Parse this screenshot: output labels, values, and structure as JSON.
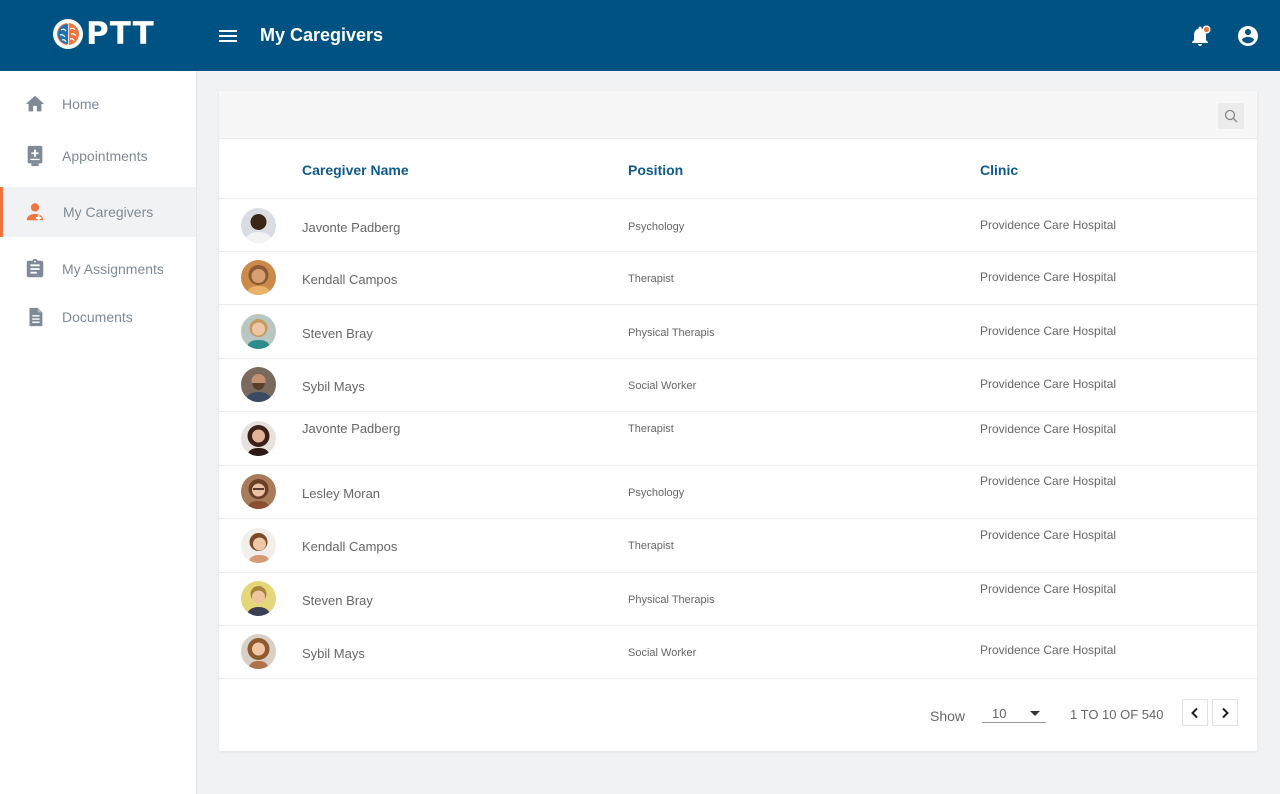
{
  "app": {
    "logo_text": "PTT"
  },
  "header": {
    "title": "My Caregivers"
  },
  "sidebar": {
    "items": [
      {
        "label": "Home",
        "icon": "home-icon"
      },
      {
        "label": "Appointments",
        "icon": "appointments-icon"
      },
      {
        "label": "My Caregivers",
        "icon": "caregiver-icon",
        "active": true
      },
      {
        "label": "My Assignments",
        "icon": "clipboard-icon"
      },
      {
        "label": "Documents",
        "icon": "document-icon"
      }
    ]
  },
  "table": {
    "headers": {
      "name": "Caregiver Name",
      "position": "Position",
      "clinic": "Clinic"
    },
    "rows": [
      {
        "name": "Javonte Padberg",
        "position": "Psychology",
        "clinic": "Providence Care Hospital"
      },
      {
        "name": "Kendall Campos",
        "position": "Therapist",
        "clinic": "Providence Care Hospital"
      },
      {
        "name": "Steven Bray",
        "position": "Physical Therapis",
        "clinic": "Providence Care Hospital"
      },
      {
        "name": "Sybil Mays",
        "position": "Social Worker",
        "clinic": "Providence Care Hospital"
      },
      {
        "name": "Javonte Padberg",
        "position": "Therapist",
        "clinic": "Providence Care Hospital"
      },
      {
        "name": "Lesley Moran",
        "position": "Psychology",
        "clinic": "Providence Care Hospital"
      },
      {
        "name": "Kendall Campos",
        "position": "Therapist",
        "clinic": "Providence Care Hospital"
      },
      {
        "name": "Steven Bray",
        "position": "Physical Therapis",
        "clinic": "Providence Care Hospital"
      },
      {
        "name": "Sybil Mays",
        "position": "Social Worker",
        "clinic": "Providence Care Hospital"
      }
    ]
  },
  "pagination": {
    "show_label": "Show",
    "page_size": "10",
    "range": "1 TO 10 OF 540"
  },
  "colors": {
    "header_bg": "#005282",
    "accent": "#f0743e",
    "link_blue": "#0e5a8a"
  }
}
